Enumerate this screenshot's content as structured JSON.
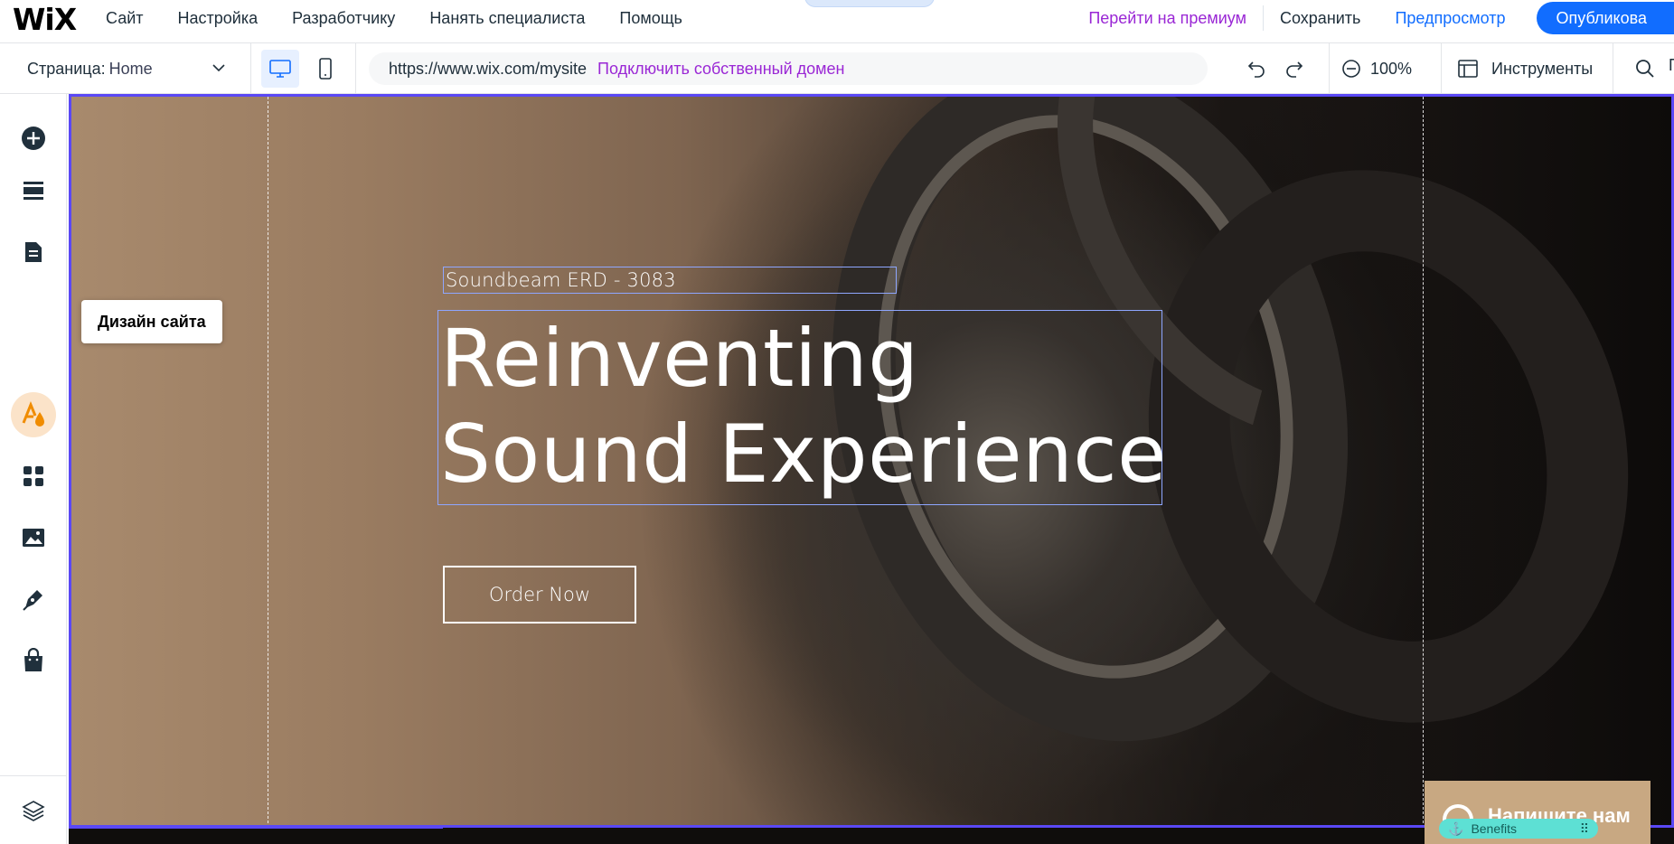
{
  "app": {
    "logo": "WiX",
    "menu": [
      "Сайт",
      "Настройка",
      "Разработчику",
      "Нанять специалиста",
      "Помощь"
    ],
    "premium_label": "Перейти на премиум",
    "save_label": "Сохранить",
    "preview_label": "Предпросмотр",
    "publish_label": "Опубликова"
  },
  "toolbar": {
    "page_prefix": "Страница:",
    "page_name": "Home",
    "url": "https://www.wix.com/mysite",
    "connect_domain": "Подключить собственный домен",
    "zoom": "100%",
    "tools_label": "Инструменты",
    "truncated": "П"
  },
  "rail": {
    "tooltip": "Дизайн сайта",
    "items": [
      "add",
      "sections",
      "pages",
      "site-design",
      "apps",
      "media",
      "blog",
      "store",
      "layers"
    ]
  },
  "canvas": {
    "subtitle": "Soundbeam ERD - 3083",
    "headline_line1": "Reinventing",
    "headline_line2": "Sound Experience",
    "cta": "Order Now",
    "chat_label": "Напишите нам",
    "anchor_label": "Benefits"
  },
  "colors": {
    "accent": "#116dff",
    "premium": "#9a27d5",
    "selection": "#5a48f5",
    "design_active": "#fbe3c9",
    "chat_bg": "#c8a882",
    "anchor_bg": "#5de0d4"
  }
}
